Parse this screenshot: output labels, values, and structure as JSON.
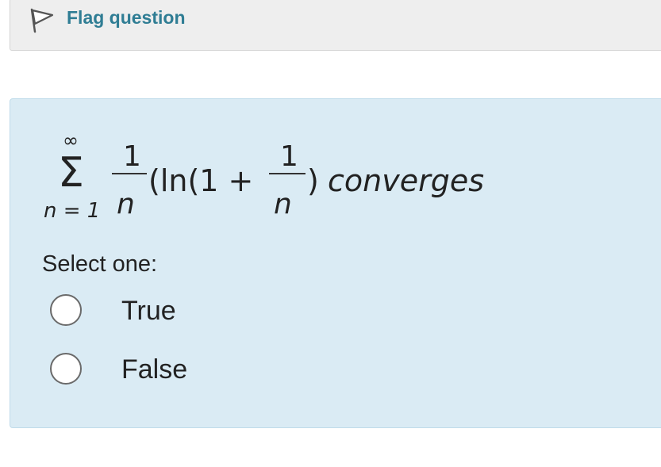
{
  "flag": {
    "label": "Flag question",
    "icon": "flag-icon"
  },
  "question": {
    "formula": {
      "sum_upper": "∞",
      "sum_lower": "n = 1",
      "frac1_num": "1",
      "frac1_den": "n",
      "middle": "(ln(1 + ",
      "frac2_num": "1",
      "frac2_den": "n",
      "close": ")",
      "statement": "converges"
    },
    "prompt": "Select one:",
    "options": [
      {
        "label": "True",
        "selected": false
      },
      {
        "label": "False",
        "selected": false
      }
    ]
  },
  "colors": {
    "link": "#2f7d94",
    "question_bg": "#daebf4",
    "flag_bg": "#eeeeee"
  }
}
